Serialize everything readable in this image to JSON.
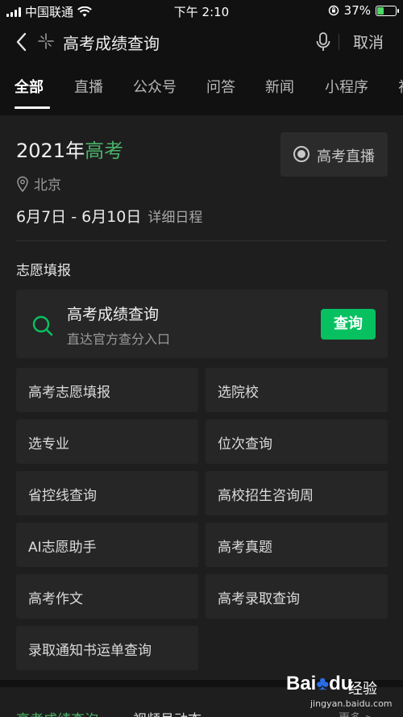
{
  "status": {
    "carrier": "中国联通",
    "time": "下午 2:10",
    "battery": "37%",
    "battery_level": 0.37
  },
  "search": {
    "back_icon": "back-chevron-icon",
    "query": "高考成绩查询",
    "cancel_label": "取消"
  },
  "tabs": [
    "全部",
    "直播",
    "公众号",
    "问答",
    "新闻",
    "小程序",
    "视"
  ],
  "card": {
    "year_prefix": "2021年",
    "year_highlight": "高考",
    "live_button": "高考直播",
    "location": "北京",
    "dates": "6月7日 - 6月10日",
    "detail_link": "详细日程",
    "section_title": "志愿填报",
    "query_box": {
      "title": "高考成绩查询",
      "subtitle": "直达官方查分入口",
      "button": "查询"
    },
    "grid": [
      "高考志愿填报",
      "选院校",
      "选专业",
      "位次查询",
      "省控线查询",
      "高校招生咨询周",
      "AI志愿助手",
      "高考真题",
      "高考作文",
      "高考录取查询",
      "录取通知书运单查询"
    ]
  },
  "footer": {
    "t1": "高考成绩查询",
    "t2": "视频号动态",
    "t3": "更多 >"
  },
  "watermark": {
    "brand_a": "Bai",
    "brand_paw": "♣",
    "brand_b": "du",
    "sub": "经验",
    "url": "jingyan.baidu.com"
  },
  "colors": {
    "accent_green": "#07c160",
    "highlight_green": "#4ab268",
    "background": "#111111",
    "card": "#1e1e1e"
  }
}
